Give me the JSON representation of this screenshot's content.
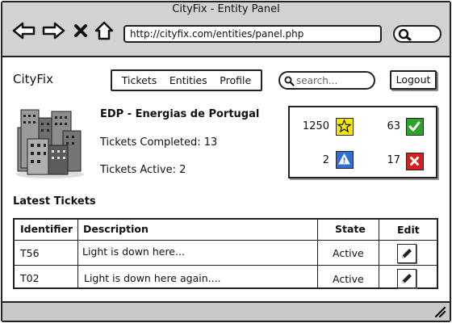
{
  "window": {
    "title": "CityFix - Entity Panel"
  },
  "browser": {
    "url": "http://cityfix.com/entities/panel.php",
    "nav_icons": [
      "back-arrow-icon",
      "forward-arrow-icon",
      "stop-icon",
      "home-icon"
    ]
  },
  "app": {
    "name": "CityFix",
    "nav": [
      "Tickets",
      "Entities",
      "Profile"
    ],
    "search_placeholder": "search...",
    "logout_label": "Logout"
  },
  "entity": {
    "name": "EDP - Energias de Portugal",
    "completed_text": "Tickets Completed: 13",
    "active_text": "Tickets Active: 2"
  },
  "stats": [
    {
      "value": "1250",
      "icon": "star-icon",
      "color": "#f5e600"
    },
    {
      "value": "63",
      "icon": "checkmark-icon",
      "color": "#2aa52a"
    },
    {
      "value": "2",
      "icon": "warning-icon",
      "color": "#2f6fd6"
    },
    {
      "value": "17",
      "icon": "x-icon",
      "color": "#d42020"
    }
  ],
  "tickets": {
    "title": "Latest Tickets",
    "headers": [
      "Identifier",
      "Description",
      "State",
      "Edit"
    ],
    "rows": [
      {
        "id": "T56",
        "description": "Light is down here...",
        "state": "Active"
      },
      {
        "id": "T02",
        "description": "Light is down here again....",
        "state": "Active"
      }
    ]
  }
}
